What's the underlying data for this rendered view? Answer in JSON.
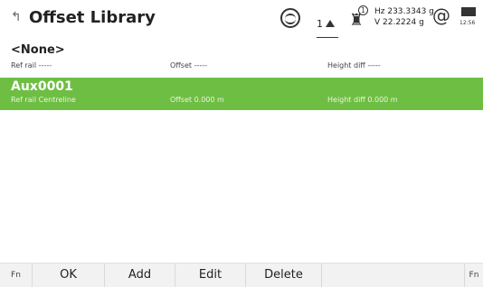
{
  "header": {
    "back_glyph": "↰",
    "title": "Offset Library",
    "face_label": "1",
    "tilt_number": "1",
    "hz_line": "Hz 233.3343 g",
    "v_line": "V   22.2224 g",
    "at_symbol": "@",
    "battery_time": "12:56"
  },
  "list": {
    "rows": [
      {
        "title": "<None>",
        "ref_rail": "Ref rail  -----",
        "offset": "Offset  -----",
        "height_diff": "Height diff  -----"
      },
      {
        "title": "Aux0001",
        "ref_rail": "Ref rail  Centreline",
        "offset": "Offset  0.000 m",
        "height_diff": "Height diff  0.000 m"
      }
    ],
    "selected_index": 1,
    "selected_color": "#6fbe44"
  },
  "footer": {
    "fn_left": "Fn",
    "ok": "OK",
    "add": "Add",
    "edit": "Edit",
    "delete": "Delete",
    "fn_right": "Fn"
  }
}
